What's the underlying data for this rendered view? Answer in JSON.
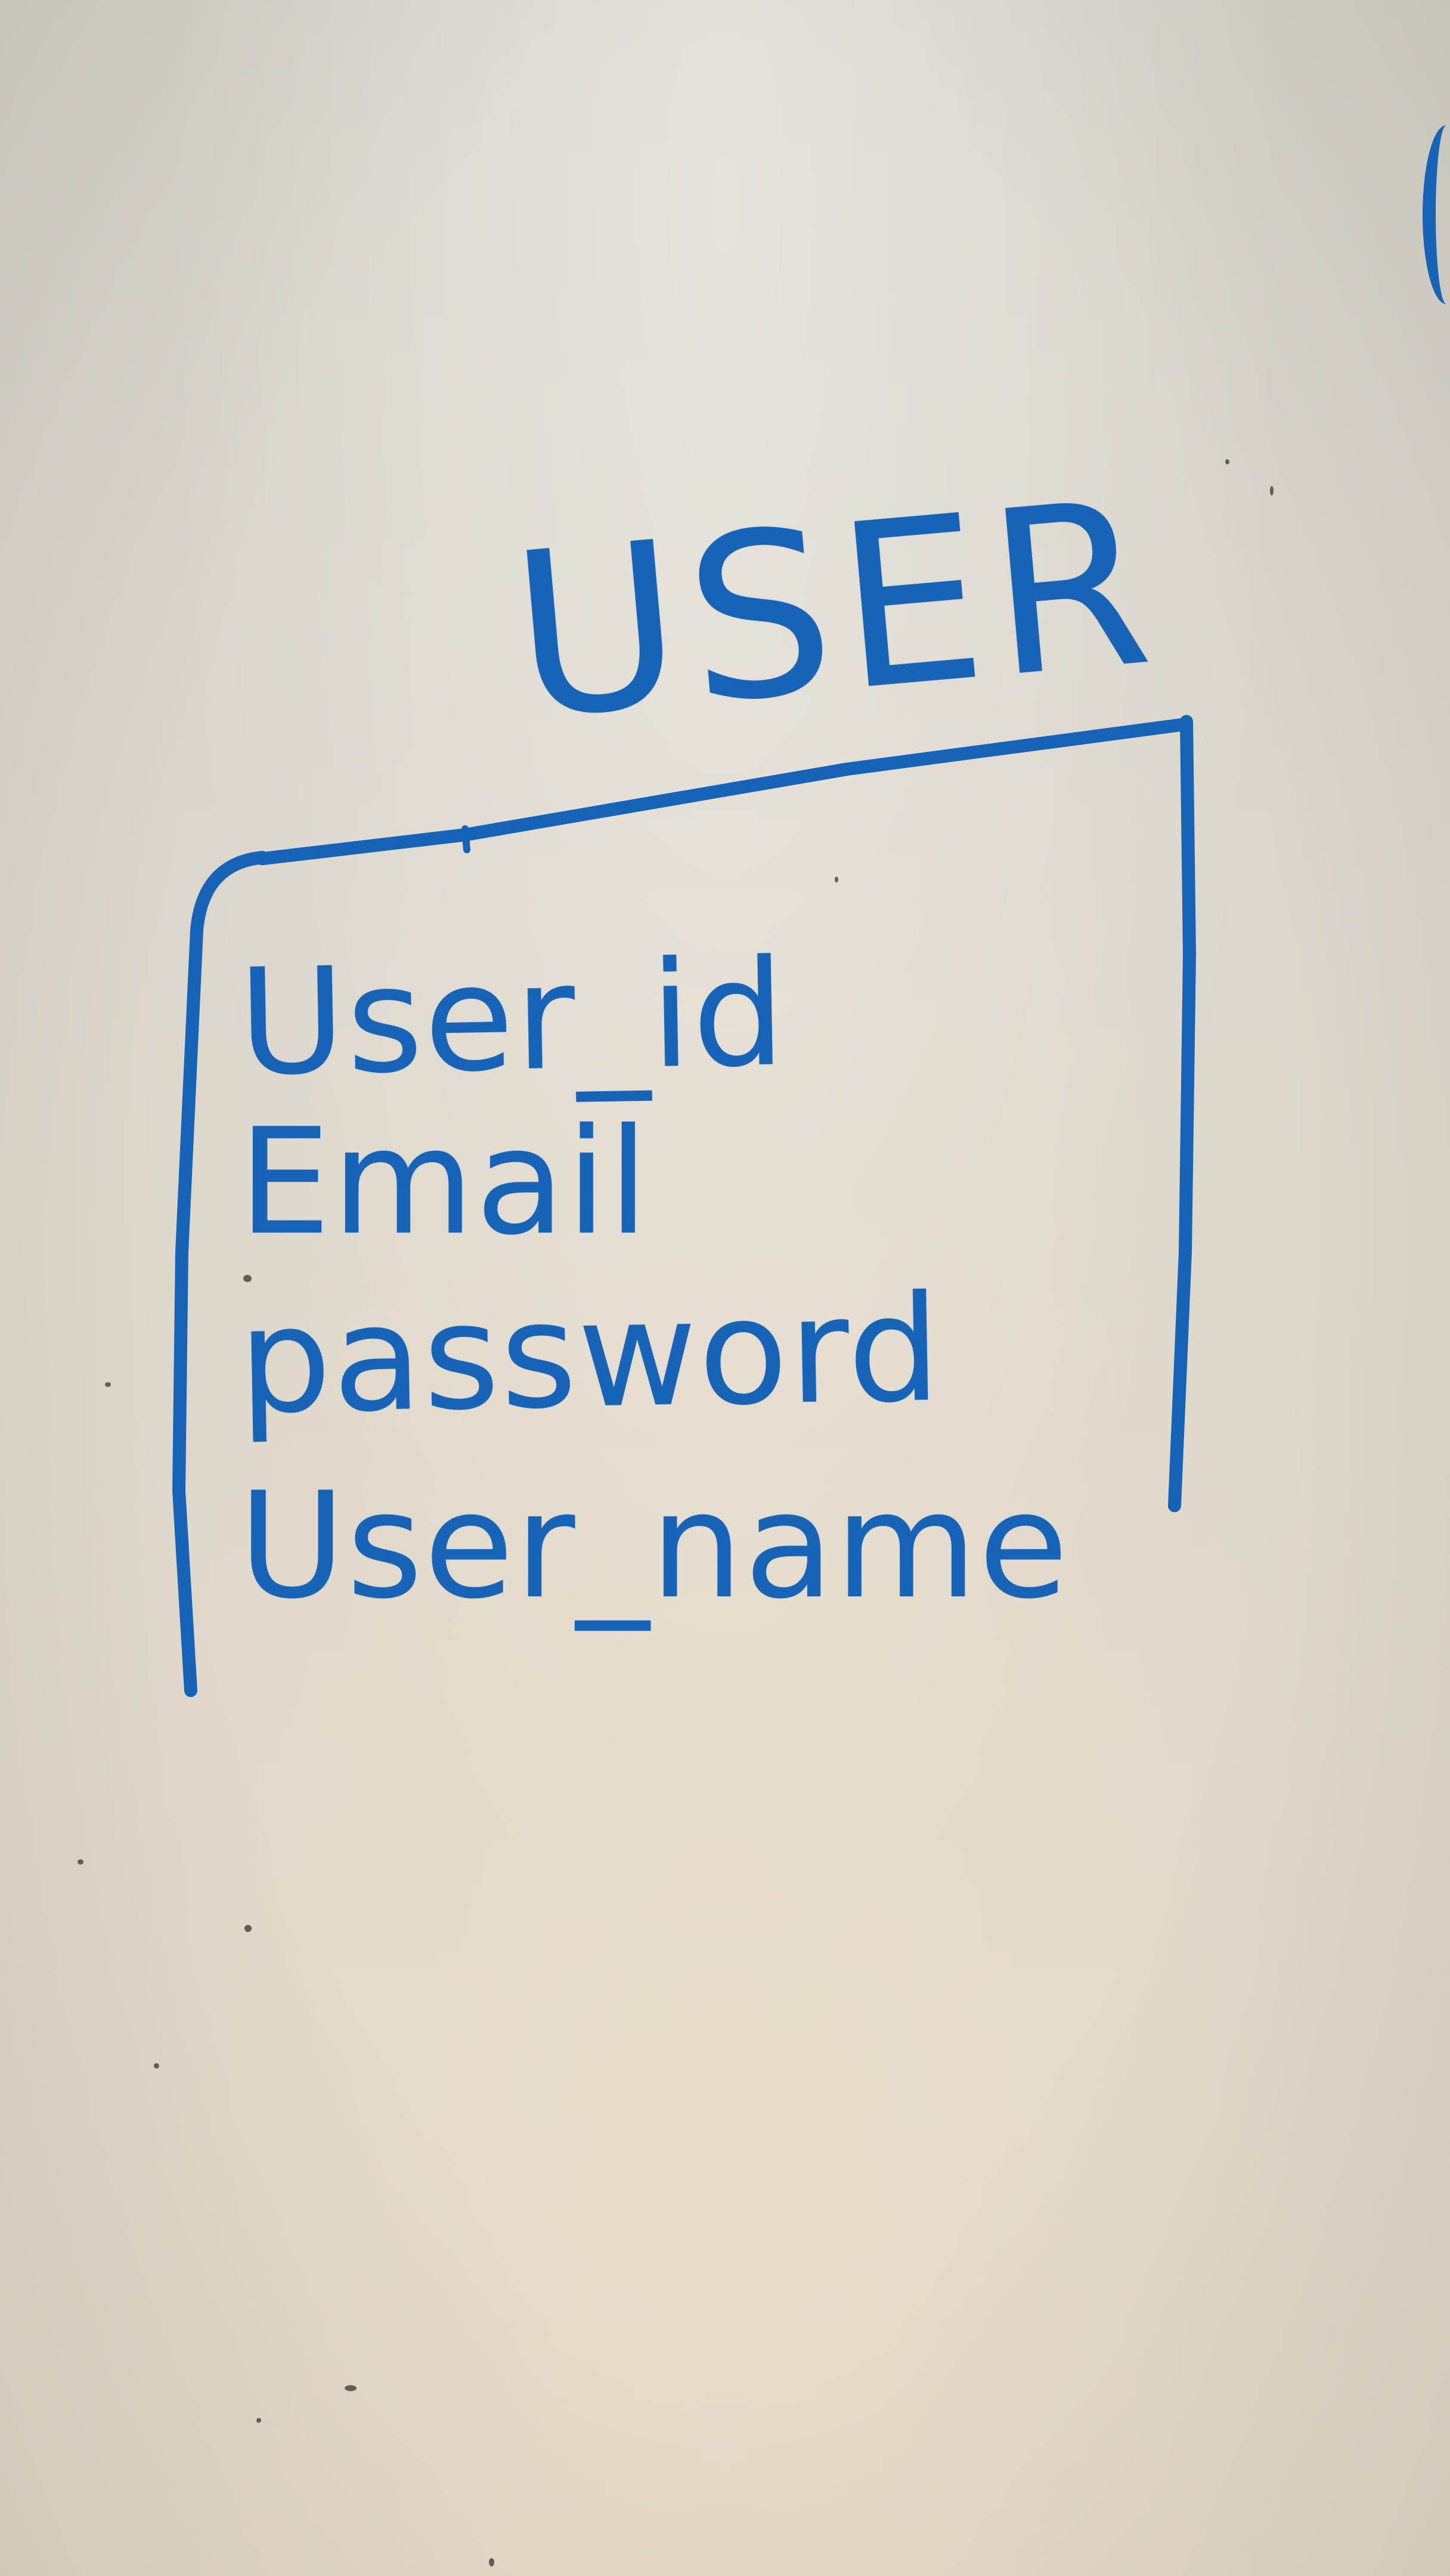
{
  "diagram": {
    "type": "entity",
    "ink_color": "#1663b8",
    "board_color": "#dcd7cc",
    "entity": {
      "title": "USER",
      "attributes": [
        "User_id",
        "Email",
        "password",
        "User_name"
      ]
    }
  }
}
